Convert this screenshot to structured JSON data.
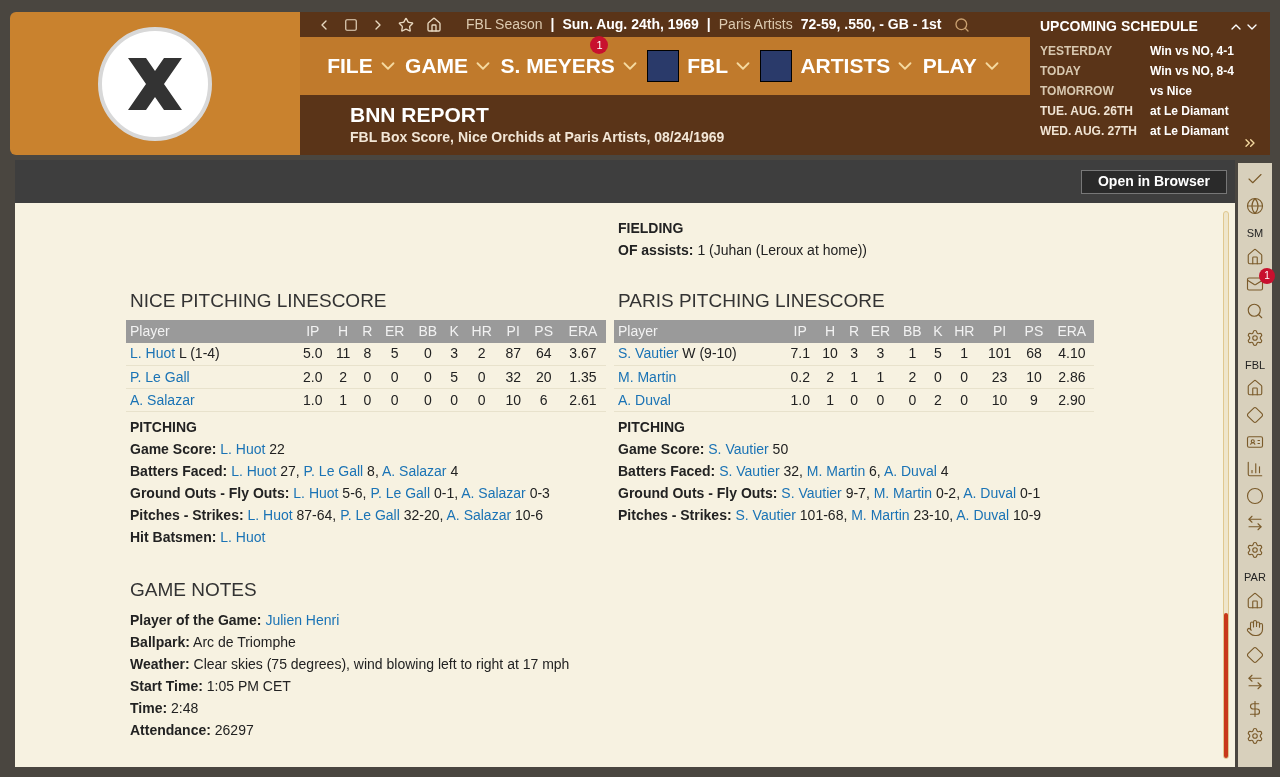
{
  "top_bar": {
    "info": [
      {
        "text": "FBL Season",
        "bold": false
      },
      {
        "text": "|",
        "bold": true
      },
      {
        "text": "Sun. Aug. 24th, 1969",
        "bold": true
      },
      {
        "text": "|",
        "bold": true
      },
      {
        "text": "Paris Artists",
        "bold": false
      },
      {
        "text": "72-59, .550, - GB - 1st",
        "bold": true
      }
    ]
  },
  "menu": [
    {
      "label": "FILE",
      "logo": false
    },
    {
      "label": "GAME",
      "logo": false
    },
    {
      "label": "S. MEYERS",
      "badge": "1",
      "logo": false
    },
    {
      "label": "FBL",
      "logo": true
    },
    {
      "label": "ARTISTS",
      "logo": true
    },
    {
      "label": "PLAY",
      "logo": false
    }
  ],
  "report": {
    "title": "BNN REPORT",
    "subtitle": "FBL Box Score, Nice Orchids at Paris Artists, 08/24/1969"
  },
  "schedule": {
    "title": "UPCOMING SCHEDULE",
    "rows": [
      {
        "day": "YESTERDAY",
        "game": "Win vs NO, 4-1",
        "past": true
      },
      {
        "day": "TODAY",
        "game": "Win vs NO, 8-4",
        "past": true
      },
      {
        "day": "TOMORROW",
        "game": "vs Nice",
        "past": true
      },
      {
        "day": "TUE. AUG. 26TH",
        "game": "at Le Diamant",
        "past": false
      },
      {
        "day": "WED. AUG. 27TH",
        "game": "at Le Diamant",
        "past": false
      }
    ]
  },
  "toolbar": {
    "button": "Open in Browser"
  },
  "side_toolbar": {
    "groups": [
      {
        "label": "SM"
      },
      {
        "label": "FBL"
      },
      {
        "label": "PAR"
      }
    ],
    "badge": "1"
  },
  "fielding": {
    "title": "FIELDING",
    "lines": [
      {
        "label": "OF assists:",
        "value": "1 (Juhan (Leroux at home))"
      }
    ]
  },
  "teams": [
    {
      "title": "NICE PITCHING LINESCORE",
      "columns": [
        "Player",
        "IP",
        "H",
        "R",
        "ER",
        "BB",
        "K",
        "HR",
        "PI",
        "PS",
        "ERA"
      ],
      "rows": [
        {
          "player": "L. Huot",
          "decision": "L (1-4)",
          "stats": [
            "5.0",
            "11",
            "8",
            "5",
            "0",
            "3",
            "2",
            "87",
            "64",
            "3.67"
          ]
        },
        {
          "player": "P. Le Gall",
          "decision": "",
          "stats": [
            "2.0",
            "2",
            "0",
            "0",
            "0",
            "5",
            "0",
            "32",
            "20",
            "1.35"
          ]
        },
        {
          "player": "A. Salazar",
          "decision": "",
          "stats": [
            "1.0",
            "1",
            "0",
            "0",
            "0",
            "0",
            "0",
            "10",
            "6",
            "2.61"
          ]
        }
      ],
      "pitching_title": "PITCHING",
      "pitching": [
        {
          "label": "Game Score:",
          "parts": [
            {
              "kind": "link",
              "text": "L. Huot"
            },
            {
              "kind": "plain",
              "text": "22"
            }
          ]
        },
        {
          "label": "Batters Faced:",
          "parts": [
            {
              "kind": "link",
              "text": "L. Huot"
            },
            {
              "kind": "plain",
              "text": "27,"
            },
            {
              "kind": "link",
              "text": "P. Le Gall"
            },
            {
              "kind": "plain",
              "text": "8,"
            },
            {
              "kind": "link",
              "text": "A. Salazar"
            },
            {
              "kind": "plain",
              "text": "4"
            }
          ]
        },
        {
          "label": "Ground Outs - Fly Outs:",
          "parts": [
            {
              "kind": "link",
              "text": "L. Huot"
            },
            {
              "kind": "plain",
              "text": "5-6,"
            },
            {
              "kind": "link",
              "text": "P. Le Gall"
            },
            {
              "kind": "plain",
              "text": "0-1,"
            },
            {
              "kind": "link",
              "text": "A. Salazar"
            },
            {
              "kind": "plain",
              "text": "0-3"
            }
          ]
        },
        {
          "label": "Pitches - Strikes:",
          "parts": [
            {
              "kind": "link",
              "text": "L. Huot"
            },
            {
              "kind": "plain",
              "text": "87-64,"
            },
            {
              "kind": "link",
              "text": "P. Le Gall"
            },
            {
              "kind": "plain",
              "text": "32-20,"
            },
            {
              "kind": "link",
              "text": "A. Salazar"
            },
            {
              "kind": "plain",
              "text": "10-6"
            }
          ]
        },
        {
          "label": "Hit Batsmen:",
          "parts": [
            {
              "kind": "link",
              "text": "L. Huot"
            }
          ]
        }
      ]
    },
    {
      "title": "PARIS PITCHING LINESCORE",
      "columns": [
        "Player",
        "IP",
        "H",
        "R",
        "ER",
        "BB",
        "K",
        "HR",
        "PI",
        "PS",
        "ERA"
      ],
      "rows": [
        {
          "player": "S. Vautier",
          "decision": "W (9-10)",
          "stats": [
            "7.1",
            "10",
            "3",
            "3",
            "1",
            "5",
            "1",
            "101",
            "68",
            "4.10"
          ]
        },
        {
          "player": "M. Martin",
          "decision": "",
          "stats": [
            "0.2",
            "2",
            "1",
            "1",
            "2",
            "0",
            "0",
            "23",
            "10",
            "2.86"
          ]
        },
        {
          "player": "A. Duval",
          "decision": "",
          "stats": [
            "1.0",
            "1",
            "0",
            "0",
            "0",
            "2",
            "0",
            "10",
            "9",
            "2.90"
          ]
        }
      ],
      "pitching_title": "PITCHING",
      "pitching": [
        {
          "label": "Game Score:",
          "parts": [
            {
              "kind": "link",
              "text": "S. Vautier"
            },
            {
              "kind": "plain",
              "text": "50"
            }
          ]
        },
        {
          "label": "Batters Faced:",
          "parts": [
            {
              "kind": "link",
              "text": "S. Vautier"
            },
            {
              "kind": "plain",
              "text": "32,"
            },
            {
              "kind": "link",
              "text": "M. Martin"
            },
            {
              "kind": "plain",
              "text": "6,"
            },
            {
              "kind": "link",
              "text": "A. Duval"
            },
            {
              "kind": "plain",
              "text": "4"
            }
          ]
        },
        {
          "label": "Ground Outs - Fly Outs:",
          "parts": [
            {
              "kind": "link",
              "text": "S. Vautier"
            },
            {
              "kind": "plain",
              "text": "9-7,"
            },
            {
              "kind": "link",
              "text": "M. Martin"
            },
            {
              "kind": "plain",
              "text": "0-2,"
            },
            {
              "kind": "link",
              "text": "A. Duval"
            },
            {
              "kind": "plain",
              "text": "0-1"
            }
          ]
        },
        {
          "label": "Pitches - Strikes:",
          "parts": [
            {
              "kind": "link",
              "text": "S. Vautier"
            },
            {
              "kind": "plain",
              "text": "101-68,"
            },
            {
              "kind": "link",
              "text": "M. Martin"
            },
            {
              "kind": "plain",
              "text": "23-10,"
            },
            {
              "kind": "link",
              "text": "A. Duval"
            },
            {
              "kind": "plain",
              "text": "10-9"
            }
          ]
        }
      ]
    }
  ],
  "game_notes": {
    "title": "GAME NOTES",
    "lines": [
      {
        "label": "Player of the Game:",
        "kind": "link",
        "value": "Julien Henri"
      },
      {
        "label": "Ballpark:",
        "kind": "plain",
        "value": "Arc de Triomphe"
      },
      {
        "label": "Weather:",
        "kind": "plain",
        "value": "Clear skies (75 degrees), wind blowing left to right at 17 mph"
      },
      {
        "label": "Start Time:",
        "kind": "plain",
        "value": "1:05 PM CET"
      },
      {
        "label": "Time:",
        "kind": "plain",
        "value": "2:48"
      },
      {
        "label": "Attendance:",
        "kind": "plain",
        "value": "26297"
      }
    ]
  }
}
